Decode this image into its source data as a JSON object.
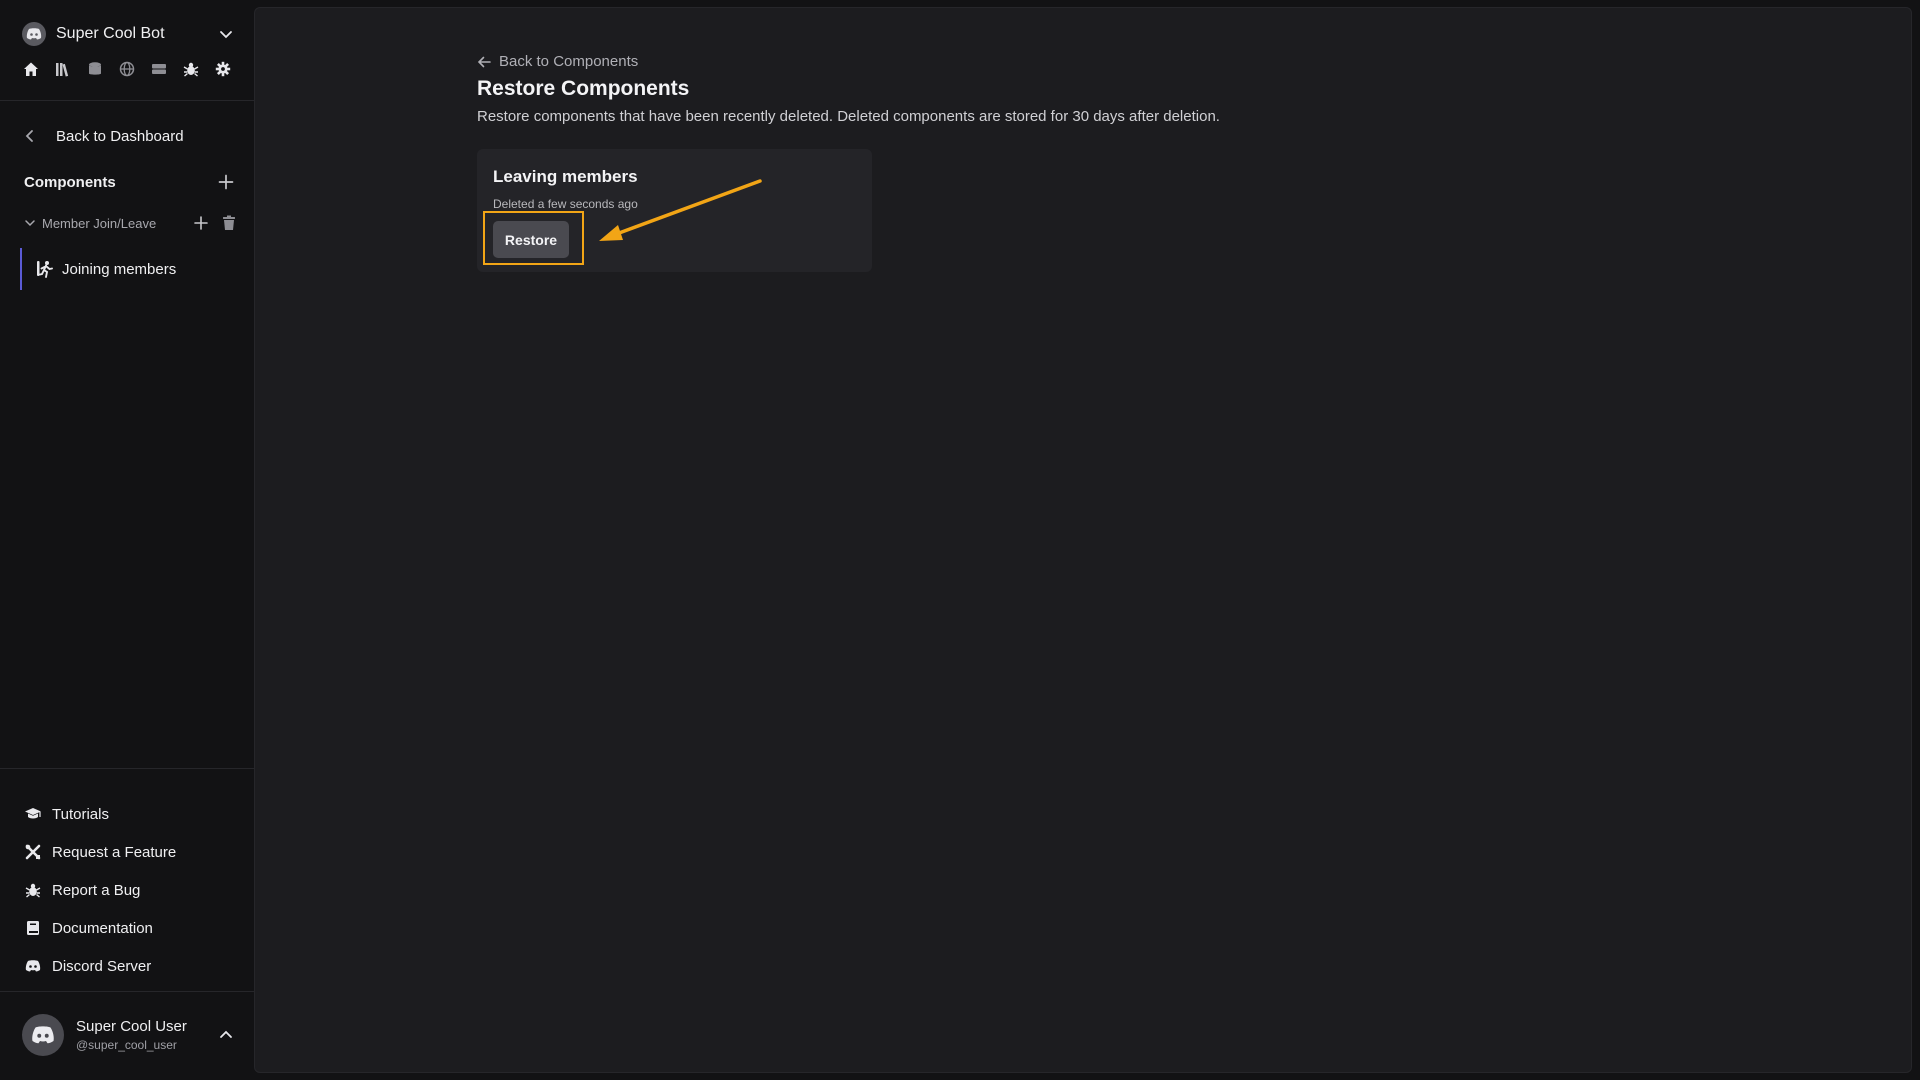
{
  "sidebar": {
    "bot_name": "Super Cool Bot",
    "quick_icons": [
      "home-icon",
      "library-icon",
      "database-icon",
      "globe-icon",
      "server-icon",
      "bug-icon",
      "gear-icon"
    ],
    "back_to_dashboard": "Back to Dashboard",
    "components_heading": "Components",
    "group": {
      "label": "Member Join/Leave",
      "children": [
        {
          "label": "Joining members",
          "icon": "running-person-icon"
        }
      ]
    },
    "bottom_nav": [
      {
        "label": "Tutorials",
        "icon": "graduation-cap-icon"
      },
      {
        "label": "Request a Feature",
        "icon": "tools-icon"
      },
      {
        "label": "Report a Bug",
        "icon": "bug-icon"
      },
      {
        "label": "Documentation",
        "icon": "book-icon"
      },
      {
        "label": "Discord Server",
        "icon": "discord-icon"
      }
    ],
    "user": {
      "name": "Super Cool User",
      "handle": "@super_cool_user"
    }
  },
  "main": {
    "back_link": "Back to Components",
    "title": "Restore Components",
    "description": "Restore components that have been recently deleted. Deleted components are stored for 30 days after deletion.",
    "deleted_items": [
      {
        "name": "Leaving members",
        "deleted_at": "Deleted a few seconds ago",
        "action_label": "Restore"
      }
    ]
  },
  "colors": {
    "highlight": "#f2a516",
    "active_indicator": "#5b5bd6",
    "background": "#121214",
    "panel": "#1c1c1f"
  }
}
